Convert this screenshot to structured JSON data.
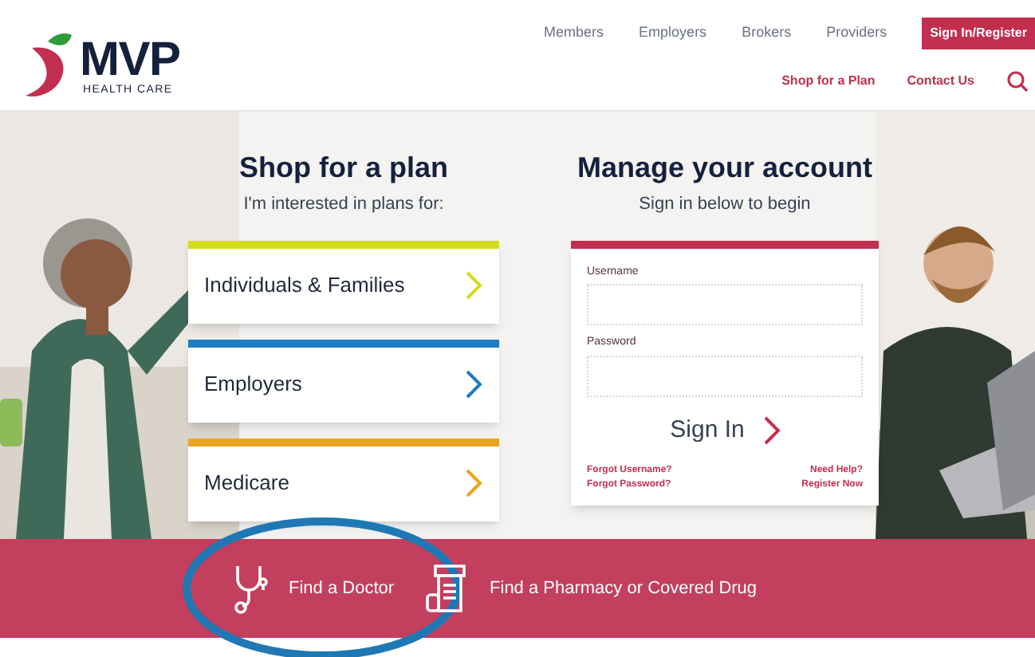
{
  "logo": {
    "name": "MVP",
    "tagline": "HEALTH CARE"
  },
  "top_nav": [
    {
      "label": "Members"
    },
    {
      "label": "Employers"
    },
    {
      "label": "Brokers"
    },
    {
      "label": "Providers"
    }
  ],
  "sign_in_button": "Sign In/Register",
  "secondary_nav": [
    {
      "label": "Shop for a Plan"
    },
    {
      "label": "Contact Us"
    }
  ],
  "shop": {
    "title": "Shop for a plan",
    "subtitle": "I'm interested in plans for:",
    "plans": [
      {
        "label": "Individuals & Families",
        "color": "#d4dc1e"
      },
      {
        "label": "Employers",
        "color": "#1e7cc4"
      },
      {
        "label": "Medicare",
        "color": "#eba421"
      }
    ]
  },
  "account": {
    "title": "Manage your account",
    "subtitle": "Sign in below to begin",
    "username_label": "Username",
    "password_label": "Password",
    "sign_in": "Sign In",
    "links_left": [
      "Forgot Username?",
      "Forgot Password?"
    ],
    "links_right": [
      "Need Help?",
      "Register Now"
    ]
  },
  "quick_links": [
    {
      "label": "Find a Doctor",
      "kind": "doctor",
      "highlighted": true
    },
    {
      "label": "Find a Pharmacy or Covered Drug",
      "kind": "pharmacy",
      "highlighted": false
    }
  ]
}
